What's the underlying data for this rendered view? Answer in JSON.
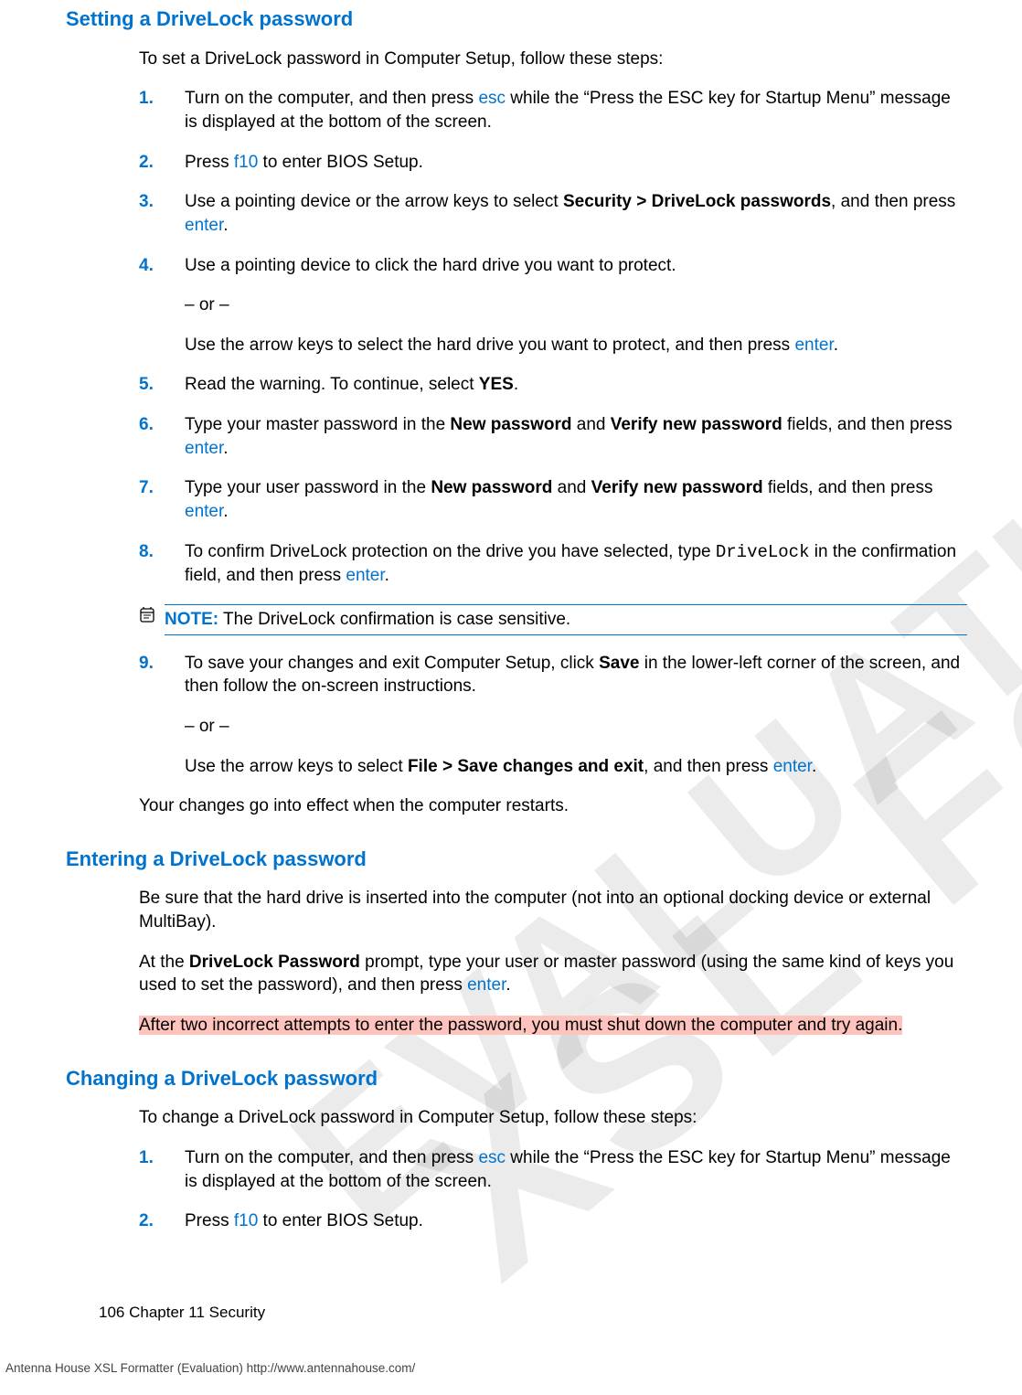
{
  "watermarks": {
    "wm1": "XSL Formatter",
    "wm2": "EVALUATION"
  },
  "section1": {
    "heading": "Setting a DriveLock password",
    "intro": "To set a DriveLock password in Computer Setup, follow these steps:",
    "steps": {
      "s1": {
        "num": "1.",
        "a": "Turn on the computer, and then press ",
        "b": "esc",
        "c": " while the “Press the ESC key for Startup Menu” message is displayed at the bottom of the screen."
      },
      "s2": {
        "num": "2.",
        "a": "Press ",
        "b": "f10",
        "c": " to enter BIOS Setup."
      },
      "s3": {
        "num": "3.",
        "a": "Use a pointing device or the arrow keys to select ",
        "b": "Security > DriveLock passwords",
        "c": ", and then press ",
        "d": "enter",
        "e": "."
      },
      "s4": {
        "num": "4.",
        "a": "Use a pointing device to click the hard drive you want to protect.",
        "or": "– or –",
        "b1": "Use the arrow keys to select the hard drive you want to protect, and then press ",
        "b2": "enter",
        "b3": "."
      },
      "s5": {
        "num": "5.",
        "a": "Read the warning. To continue, select ",
        "b": "YES",
        "c": "."
      },
      "s6": {
        "num": "6.",
        "a": "Type your master password in the ",
        "b": "New password",
        "c": " and ",
        "d": "Verify new password",
        "e": " fields, and then press ",
        "f": "enter",
        "g": "."
      },
      "s7": {
        "num": "7.",
        "a": "Type your user password in the ",
        "b": "New password",
        "c": " and ",
        "d": "Verify new password",
        "e": " fields, and then press ",
        "f": "enter",
        "g": "."
      },
      "s8": {
        "num": "8.",
        "a": "To confirm DriveLock protection on the drive you have selected, type ",
        "b": "DriveLock",
        "c": " in the confirmation field, and then press ",
        "d": "enter",
        "e": "."
      },
      "note": {
        "label": "NOTE:",
        "text": "   The DriveLock confirmation is case sensitive."
      },
      "s9": {
        "num": "9.",
        "a": "To save your changes and exit Computer Setup, click ",
        "b": "Save",
        "c": " in the lower-left corner of the screen, and then follow the on-screen instructions.",
        "or": "– or –",
        "d1": "Use the arrow keys to select ",
        "d2": "File > Save changes and exit",
        "d3": ", and then press ",
        "d4": "enter",
        "d5": "."
      }
    },
    "after": "Your changes go into effect when the computer restarts."
  },
  "section2": {
    "heading": "Entering a DriveLock password",
    "p1": "Be sure that the hard drive is inserted into the computer (not into an optional docking device or external MultiBay).",
    "p2": {
      "a": "At the ",
      "b": "DriveLock Password",
      "c": " prompt, type your user or master password (using the same kind of keys you used to set the password), and then press ",
      "d": "enter",
      "e": "."
    },
    "p3": "After two incorrect attempts to enter the password, you must shut down the computer and try again."
  },
  "section3": {
    "heading": "Changing a DriveLock password",
    "intro": "To change a DriveLock password in Computer Setup, follow these steps:",
    "steps": {
      "s1": {
        "num": "1.",
        "a": "Turn on the computer, and then press ",
        "b": "esc",
        "c": " while the “Press the ESC key for Startup Menu” message is displayed at the bottom of the screen."
      },
      "s2": {
        "num": "2.",
        "a": "Press ",
        "b": "f10",
        "c": " to enter BIOS Setup."
      }
    }
  },
  "footer": {
    "page": "106",
    "chapter": "   Chapter 11   Security"
  },
  "bottom": "Antenna House XSL Formatter (Evaluation)  http://www.antennahouse.com/"
}
